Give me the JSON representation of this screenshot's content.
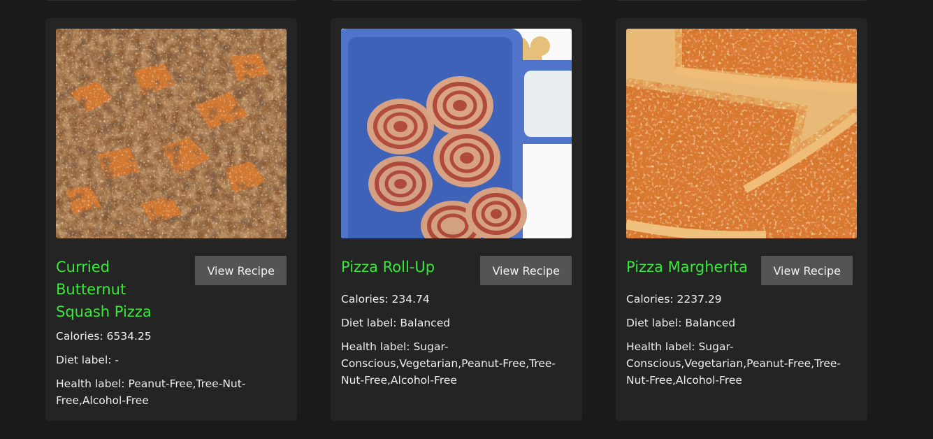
{
  "recipes": [
    {
      "title": "Curried Butternut Squash Pizza",
      "button": "View Recipe",
      "calories": "Calories: 6534.25",
      "diet": "Diet label: -",
      "health": "Health label: Peanut-Free,Tree-Nut-Free,Alcohol-Free",
      "image": "squash-pizza-photo"
    },
    {
      "title": "Pizza Roll-Up",
      "button": "View Recipe",
      "calories": "Calories: 234.74",
      "diet": "Diet label: Balanced",
      "health": "Health label: Sugar-Conscious,Vegetarian,Peanut-Free,Tree-Nut-Free,Alcohol-Free",
      "image": "pizza-rollup-lunchbox-photo"
    },
    {
      "title": "Pizza Margherita",
      "button": "View Recipe",
      "calories": "Calories: 2237.29",
      "diet": "Diet label: Balanced",
      "health": "Health label: Sugar-Conscious,Vegetarian,Peanut-Free,Tree-Nut-Free,Alcohol-Free",
      "image": "pizza-margherita-photo"
    }
  ],
  "colors": {
    "background": "#1a1a1a",
    "card": "#242424",
    "title": "#39e83b",
    "button": "#545454"
  }
}
